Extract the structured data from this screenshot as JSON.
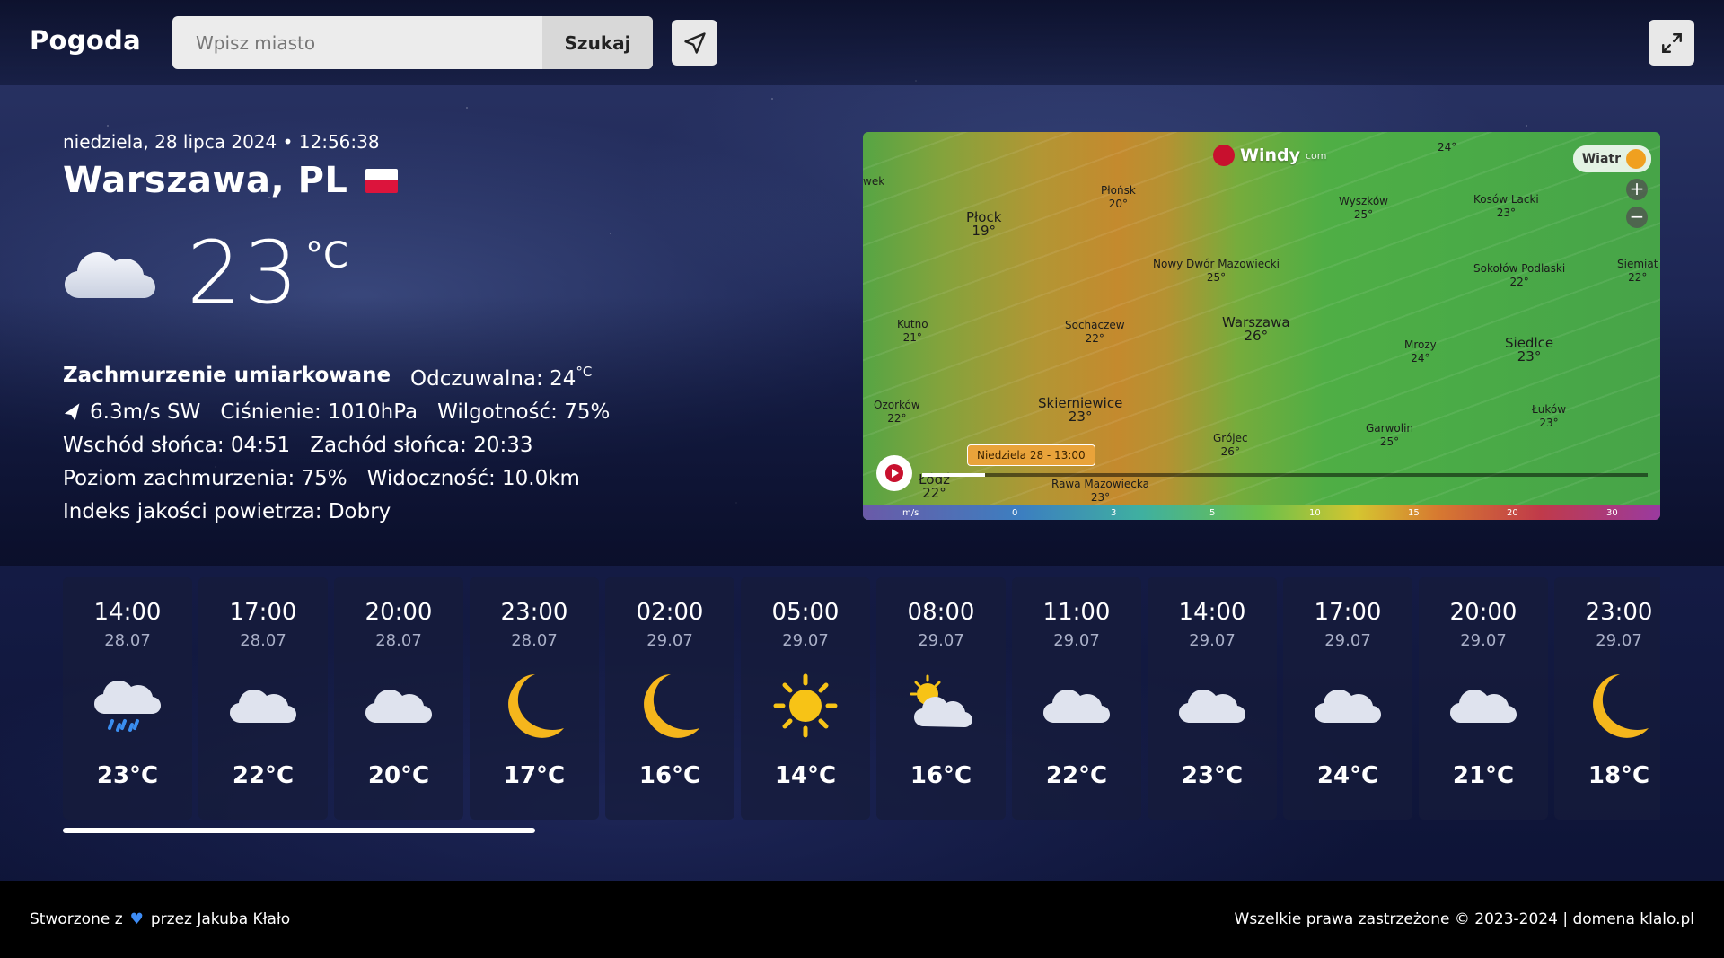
{
  "header": {
    "logo": "Pogoda",
    "search_placeholder": "Wpisz miasto",
    "search_button": "Szukaj",
    "location_icon": "navigation-arrow-icon",
    "fullscreen_icon": "expand-icon"
  },
  "current": {
    "datetime": "niedziela, 28 lipca 2024 • 12:56:38",
    "city": "Warszawa, PL",
    "icon": "cloud-icon",
    "temperature": "23",
    "unit": "°C",
    "description": "Zachmurzenie umiarkowane",
    "feels_like_label": "Odczuwalna: 24",
    "feels_like_unit": "°C",
    "wind": "6.3m/s SW",
    "pressure": "Ciśnienie: 1010hPa",
    "humidity": "Wilgotność: 75%",
    "sunrise": "Wschód słońca: 04:51",
    "sunset": "Zachód słońca: 20:33",
    "clouds": "Poziom zachmurzenia: 75%",
    "visibility": "Widoczność: 10.0km",
    "air_quality": "Indeks jakości powietrza: Dobry"
  },
  "map": {
    "brand": "Windy",
    "brand_suffix": "com",
    "layer": "Wiatr",
    "time_label": "Niedziela 28 - 13:00",
    "scale_unit": "m/s",
    "scale": [
      "0",
      "3",
      "5",
      "10",
      "15",
      "20",
      "30"
    ],
    "labels": [
      {
        "name": "wek",
        "temp": ""
      },
      {
        "name": "Płock",
        "temp": "19°"
      },
      {
        "name": "Płońsk",
        "temp": "20°"
      },
      {
        "name": "",
        "temp": "24°"
      },
      {
        "name": "Wyszków",
        "temp": "25°"
      },
      {
        "name": "Kosów Lacki",
        "temp": "23°"
      },
      {
        "name": "Nowy Dwór Mazowiecki",
        "temp": "25°"
      },
      {
        "name": "Sokołów Podlaski",
        "temp": "22°"
      },
      {
        "name": "Siemiat",
        "temp": "22°"
      },
      {
        "name": "Kutno",
        "temp": "21°"
      },
      {
        "name": "Sochaczew",
        "temp": "22°"
      },
      {
        "name": "Warszawa",
        "temp": "26°"
      },
      {
        "name": "Mrozy",
        "temp": "24°"
      },
      {
        "name": "Siedlce",
        "temp": "23°"
      },
      {
        "name": "Ozorków",
        "temp": "22°"
      },
      {
        "name": "Skierniewice",
        "temp": "23°"
      },
      {
        "name": "Grójec",
        "temp": "26°"
      },
      {
        "name": "Garwolin",
        "temp": "25°"
      },
      {
        "name": "Łuków",
        "temp": "23°"
      },
      {
        "name": "Łódź",
        "temp": "22°"
      },
      {
        "name": "Rawa Mazowiecka",
        "temp": "23°"
      }
    ]
  },
  "forecast": [
    {
      "time": "14:00",
      "date": "28.07",
      "icon": "rain-cloud-icon",
      "temp": "23°C"
    },
    {
      "time": "17:00",
      "date": "28.07",
      "icon": "cloud-icon",
      "temp": "22°C"
    },
    {
      "time": "20:00",
      "date": "28.07",
      "icon": "cloud-icon",
      "temp": "20°C"
    },
    {
      "time": "23:00",
      "date": "28.07",
      "icon": "moon-icon",
      "temp": "17°C"
    },
    {
      "time": "02:00",
      "date": "29.07",
      "icon": "moon-icon",
      "temp": "16°C"
    },
    {
      "time": "05:00",
      "date": "29.07",
      "icon": "sun-icon",
      "temp": "14°C"
    },
    {
      "time": "08:00",
      "date": "29.07",
      "icon": "sun-cloud-icon",
      "temp": "16°C"
    },
    {
      "time": "11:00",
      "date": "29.07",
      "icon": "cloud-icon",
      "temp": "22°C"
    },
    {
      "time": "14:00",
      "date": "29.07",
      "icon": "cloud-icon",
      "temp": "23°C"
    },
    {
      "time": "17:00",
      "date": "29.07",
      "icon": "cloud-icon",
      "temp": "24°C"
    },
    {
      "time": "20:00",
      "date": "29.07",
      "icon": "cloud-icon",
      "temp": "21°C"
    },
    {
      "time": "23:00",
      "date": "29.07",
      "icon": "moon-icon",
      "temp": "18°C"
    }
  ],
  "footer": {
    "left_pre": "Stworzone z",
    "left_post": "przez Jakuba Kłało",
    "right": "Wszelkie prawa zastrzeżone © 2023-2024 | domena klalo.pl"
  }
}
